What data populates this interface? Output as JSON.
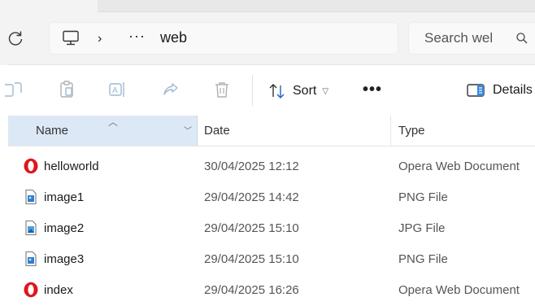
{
  "address": {
    "location_icon": "computer-icon",
    "separator": "›",
    "overflow": "···",
    "current_folder": "web"
  },
  "search": {
    "placeholder": "Search wel"
  },
  "toolbar": {
    "sort_label": "Sort",
    "more_label": "•••",
    "details_label": "Details",
    "icons": [
      "copy-icon",
      "paste-icon",
      "rename-icon",
      "share-icon",
      "delete-icon",
      "sort-icon",
      "details-pane-icon"
    ]
  },
  "columns": {
    "name": "Name",
    "date": "Date",
    "type": "Type"
  },
  "files": [
    {
      "name": "helloworld",
      "date": "30/04/2025 12:12",
      "type": "Opera Web Document",
      "icon": "opera-icon"
    },
    {
      "name": "image1",
      "date": "29/04/2025 14:42",
      "type": "PNG File",
      "icon": "image-file-icon"
    },
    {
      "name": "image2",
      "date": "29/04/2025 15:10",
      "type": "JPG File",
      "icon": "image-file-icon"
    },
    {
      "name": "image3",
      "date": "29/04/2025 15:10",
      "type": "PNG File",
      "icon": "image-file-icon"
    },
    {
      "name": "index",
      "date": "29/04/2025 16:26",
      "type": "Opera Web Document",
      "icon": "opera-icon"
    }
  ],
  "colors": {
    "selected_header": "#dce8f5",
    "opera_red": "#e0141e",
    "image_icon_blue": "#2f7fd1"
  }
}
